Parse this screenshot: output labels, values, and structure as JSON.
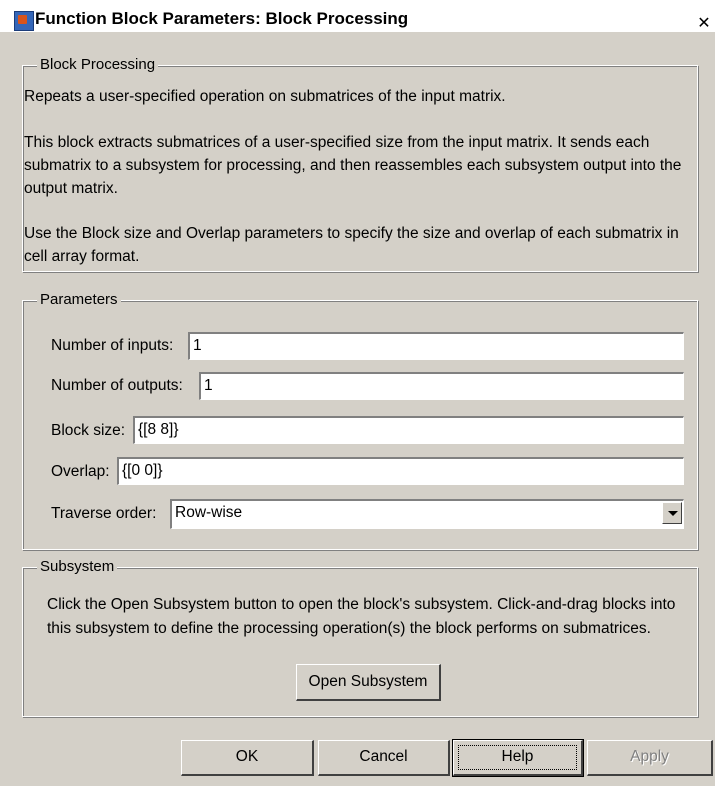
{
  "window": {
    "title": "Function Block Parameters: Block Processing",
    "close_glyph": "✕"
  },
  "block_processing": {
    "legend": "Block Processing",
    "para1": "Repeats a user-specified operation on submatrices of the input matrix.",
    "para2": "This block extracts submatrices of a user-specified size from the input matrix. It sends each submatrix to a subsystem for processing, and then reassembles each subsystem output into the output matrix.",
    "para3": "Use the Block size and Overlap parameters to specify the size and overlap of each submatrix in cell array format."
  },
  "parameters": {
    "legend": "Parameters",
    "num_inputs_label": "Number of inputs:",
    "num_inputs_value": "1",
    "num_outputs_label": "Number of outputs:",
    "num_outputs_value": "1",
    "block_size_label": "Block size:",
    "block_size_value": "{[8 8]}",
    "overlap_label": "Overlap:",
    "overlap_value": "{[0 0]}",
    "traverse_label": "Traverse order:",
    "traverse_value": "Row-wise"
  },
  "subsystem": {
    "legend": "Subsystem",
    "description": "Click the Open Subsystem button to open the block's subsystem. Click-and-drag blocks into this subsystem to define the processing operation(s) the block performs on submatrices.",
    "open_button": "Open Subsystem"
  },
  "buttons": {
    "ok": "OK",
    "cancel": "Cancel",
    "help": "Help",
    "apply": "Apply"
  }
}
